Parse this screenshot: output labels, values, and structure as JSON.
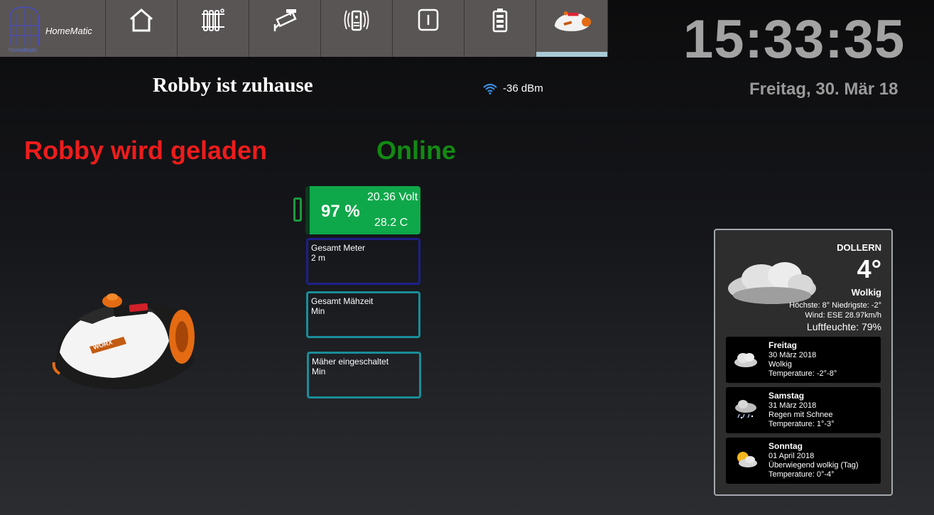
{
  "nav": {
    "logo_label": "HomeMatic",
    "logo_small": "HomeMatic",
    "items": [
      {
        "icon": "house-icon"
      },
      {
        "icon": "radiator-icon"
      },
      {
        "icon": "camera-icon"
      },
      {
        "icon": "remote-icon"
      },
      {
        "icon": "switch-icon"
      },
      {
        "icon": "battery-icon"
      },
      {
        "icon": "mower-icon",
        "active": true
      }
    ]
  },
  "clock": {
    "time": "15:33:35",
    "date": "Freitag, 30. Mär 18"
  },
  "status": {
    "home": "Robby ist zuhause",
    "wifi": "-36 dBm",
    "charging": "Robby wird geladen",
    "online": "Online"
  },
  "battery": {
    "percent": "97 %",
    "voltage": "20.36 Volt",
    "temperature": "28.2 C",
    "level": 0.97
  },
  "boxes": [
    {
      "title": "Gesamt Meter",
      "value": "2 m"
    },
    {
      "title": "Gesamt Mähzeit",
      "value": "Min"
    },
    {
      "title": "Mäher eingeschaltet",
      "value": "Min"
    }
  ],
  "weather": {
    "city": "DOLLERN",
    "temp": "4°",
    "condition": "Wolkig",
    "hilo": "Höchste: 8° Niedrigste: -2°",
    "wind": "Wind: ESE 28.97km/h",
    "humidity": "Luftfeuchte: 79%",
    "forecast": [
      {
        "day": "Freitag",
        "date": "30 März 2018",
        "cond": "Wolkig",
        "temp": "Temperature: -2°-8°",
        "icon": "cloud-icon"
      },
      {
        "day": "Samstag",
        "date": "31 März 2018",
        "cond": "Regen mit Schnee",
        "temp": "Temperature: 1°-3°",
        "icon": "rain-snow-icon"
      },
      {
        "day": "Sonntag",
        "date": "01 April 2018",
        "cond": "Überwiegend wolkig (Tag)",
        "temp": "Temperature: 0°-4°",
        "icon": "sun-cloud-icon"
      }
    ]
  }
}
